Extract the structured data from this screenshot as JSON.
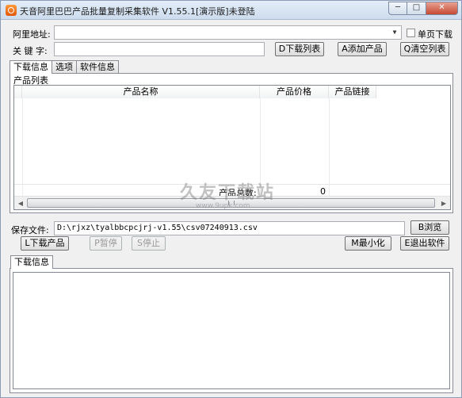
{
  "window": {
    "title": "天音阿里巴巴产品批量复制采集软件 V1.55.1[演示版]未登陆",
    "buttons": {
      "minimize": "─",
      "maximize": "□",
      "close": "✕"
    }
  },
  "form": {
    "url_label": "阿里地址:",
    "url_value": "",
    "single_page_label": "单页下载",
    "keyword_label": "关 键 字:",
    "keyword_value": "",
    "download_list_button": "D下载列表",
    "add_product_button": "A添加产品",
    "clear_list_button": "Q清空列表"
  },
  "tabs": [
    {
      "label": "下载信息",
      "active": true
    },
    {
      "label": "选项",
      "active": false
    },
    {
      "label": "软件信息",
      "active": false
    }
  ],
  "product_list": {
    "group_title": "产品列表",
    "columns": [
      "产品名称",
      "产品价格",
      "产品链接"
    ],
    "rows": [],
    "total_label": "产品总数:",
    "total_value": "0"
  },
  "watermark": {
    "text": "久友下载站",
    "url": "www.9upk.com"
  },
  "save": {
    "label": "保存文件:",
    "path": "D:\\rjxz\\tyalbbcpcjrj-v1.55\\csv07240913.csv",
    "browse_button": "B浏览"
  },
  "actions": {
    "download_button": "L下载产品",
    "pause_button": "P暂停",
    "stop_button": "S停止",
    "minimize_button": "M最小化",
    "exit_button": "E退出软件"
  },
  "log": {
    "tab_label": "下载信息",
    "content": ""
  },
  "icons": {
    "app": "app-logo-icon",
    "dropdown": "chevron-down-icon",
    "scroll_left": "arrow-left-icon",
    "scroll_right": "arrow-right-icon",
    "scroll_grip": "grip-icon"
  }
}
